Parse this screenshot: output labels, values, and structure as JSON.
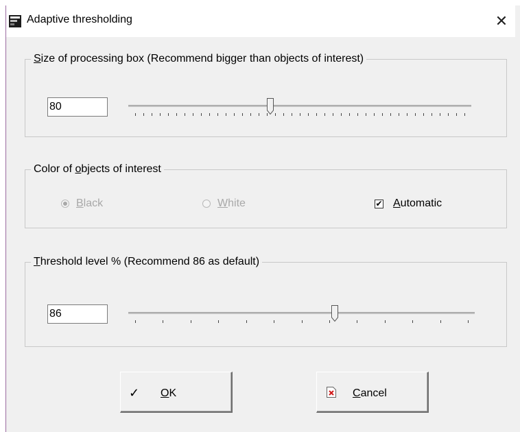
{
  "window": {
    "title": "Adaptive thresholding",
    "close_glyph": "✕",
    "app_icon": "app-icon"
  },
  "box_size": {
    "legend_mnemonic": "S",
    "legend_rest": "ize of processing box  (Recommend bigger than objects of interest)",
    "value": "80",
    "slider_fraction": 0.41
  },
  "color_group": {
    "legend_pre": "Color of ",
    "legend_mnemonic": "o",
    "legend_post": "bjects of interest",
    "black_mnemonic": "B",
    "black_rest": "lack",
    "black_checked": true,
    "white_mnemonic": "W",
    "white_rest": "hite",
    "white_checked": false,
    "automatic_mnemonic": "A",
    "automatic_rest": "utomatic",
    "automatic_checked": true,
    "check_glyph": "✔"
  },
  "threshold": {
    "legend_mnemonic": "T",
    "legend_rest": "hreshold level %  (Recommend 86 as default)",
    "value": "86",
    "slider_fraction": 0.6
  },
  "buttons": {
    "ok_icon_glyph": "✓",
    "ok_mnemonic": "O",
    "ok_rest": "K",
    "cancel_mnemonic": "C",
    "cancel_rest": "ancel"
  }
}
